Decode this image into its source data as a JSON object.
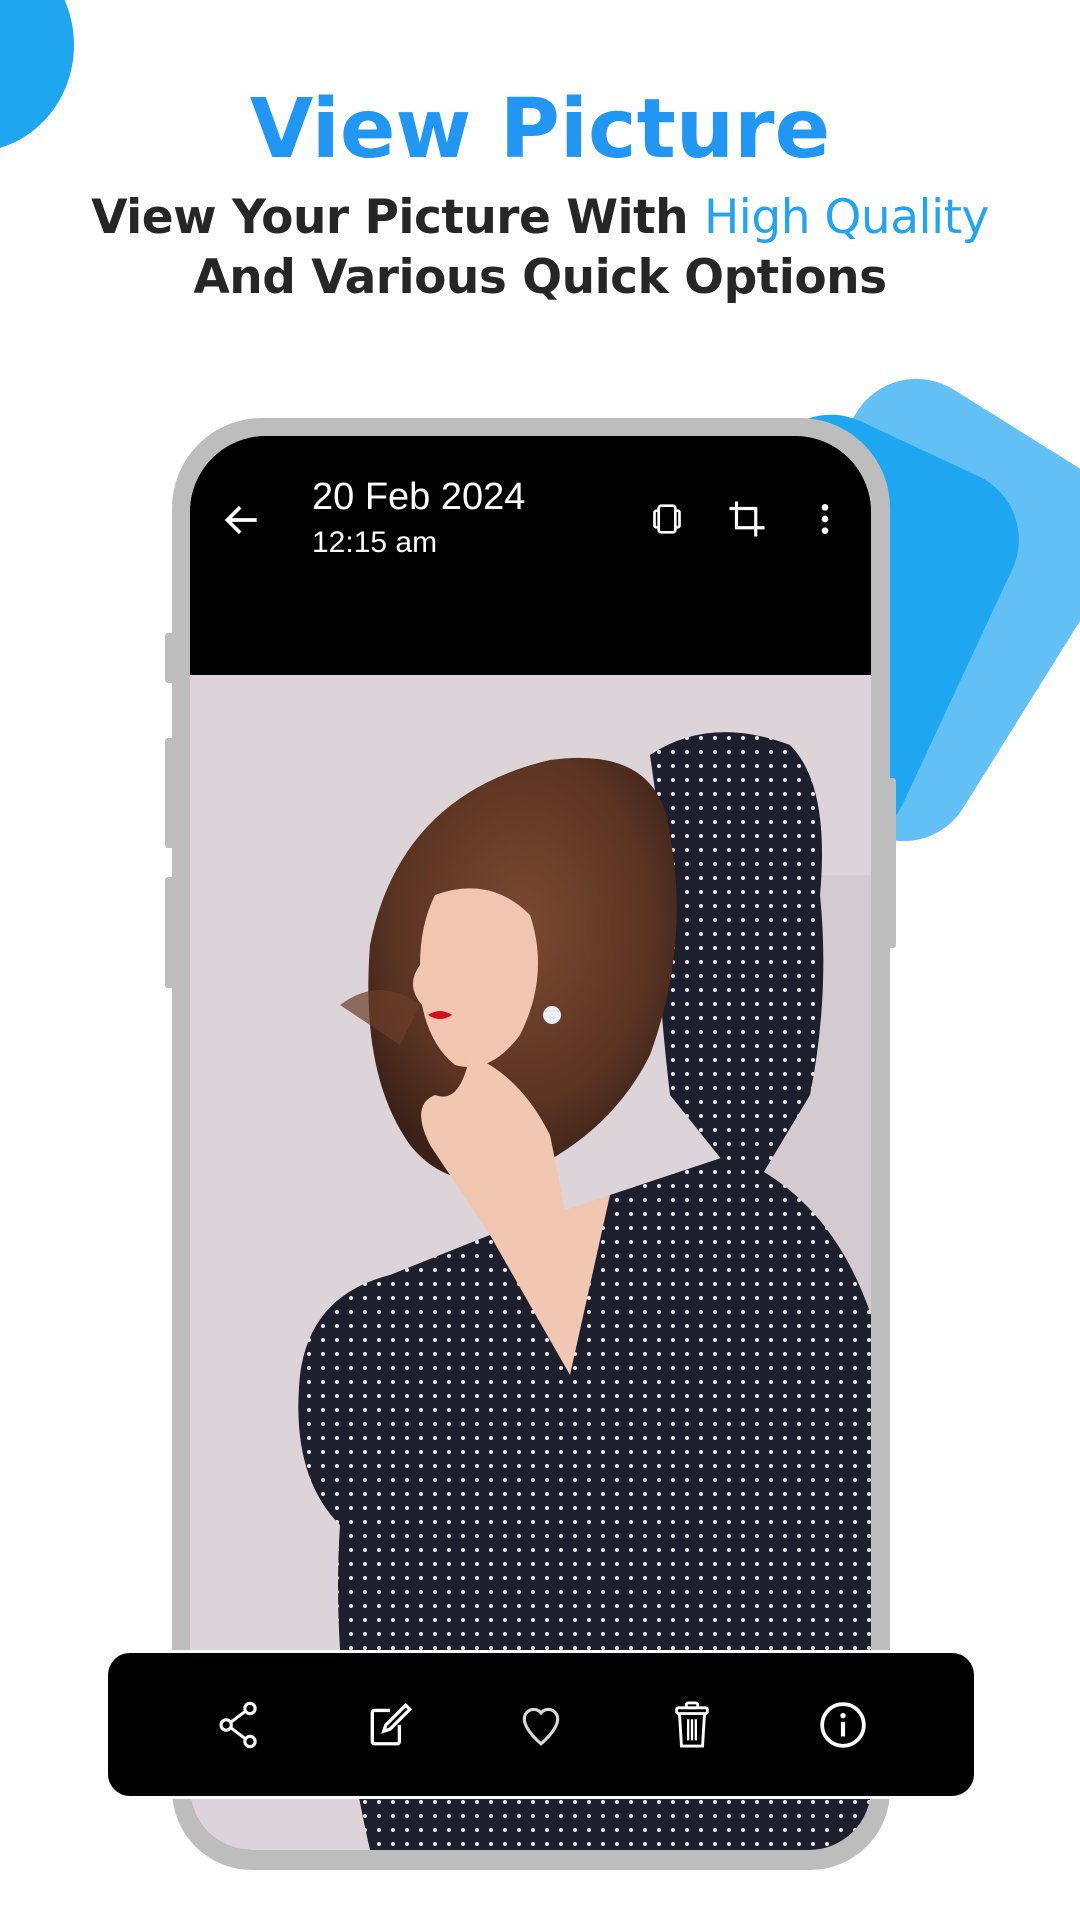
{
  "headline": {
    "title": "View Picture",
    "subtitle_part1": "View Your Picture With ",
    "subtitle_highlight": "High Quality",
    "subtitle_line2": "And Various Quick Options"
  },
  "colors": {
    "accent": "#2196f3",
    "highlight": "#22a4f0",
    "text_dark": "#262626",
    "frame": "#bdbdbd"
  },
  "viewer": {
    "date": "20 Feb 2024",
    "time": "12:15 am",
    "top_actions": [
      {
        "icon": "back-arrow-icon"
      },
      {
        "icon": "slideshow-icon"
      },
      {
        "icon": "crop-icon"
      },
      {
        "icon": "more-vert-icon"
      }
    ],
    "photo_description": "Woman with brown hair and red lipstick in a navy polka-dot blouse, arm raised behind head",
    "bottom_actions": [
      {
        "icon": "share-icon"
      },
      {
        "icon": "edit-icon"
      },
      {
        "icon": "favorite-icon"
      },
      {
        "icon": "delete-icon"
      },
      {
        "icon": "info-icon"
      }
    ]
  }
}
